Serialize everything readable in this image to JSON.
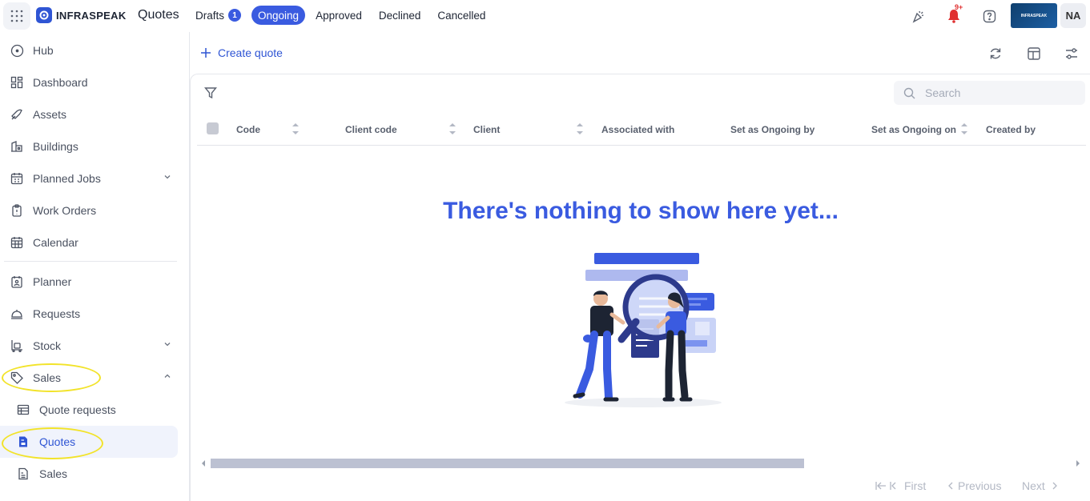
{
  "app": {
    "brand": "INFRASPEAK",
    "title": "Quotes",
    "org_logo_text": "INFRASPEAK",
    "user_initials": "NA"
  },
  "tabs": [
    {
      "label": "Drafts",
      "badge": "1"
    },
    {
      "label": "Ongoing",
      "active": true
    },
    {
      "label": "Approved"
    },
    {
      "label": "Declined"
    },
    {
      "label": "Cancelled"
    }
  ],
  "notifications": {
    "count": "9+"
  },
  "sidebar": {
    "items": [
      {
        "label": "Hub",
        "icon": "hub-icon"
      },
      {
        "label": "Dashboard",
        "icon": "dashboard-icon"
      },
      {
        "label": "Assets",
        "icon": "assets-icon"
      },
      {
        "label": "Buildings",
        "icon": "buildings-icon"
      },
      {
        "label": "Planned Jobs",
        "icon": "calendar-check-icon"
      },
      {
        "label": "Work Orders",
        "icon": "clipboard-icon"
      },
      {
        "label": "Calendar",
        "icon": "calendar-icon"
      },
      {
        "label": "Planner",
        "icon": "planner-icon"
      },
      {
        "label": "Requests",
        "icon": "bell-service-icon"
      },
      {
        "label": "Stock",
        "icon": "stock-icon"
      },
      {
        "label": "Sales",
        "icon": "tag-icon"
      },
      {
        "label": "Quote requests",
        "icon": "table-icon"
      },
      {
        "label": "Quotes",
        "icon": "quote-icon"
      },
      {
        "label": "Sales",
        "icon": "sales-doc-icon"
      }
    ]
  },
  "toolbar": {
    "create_label": "Create quote"
  },
  "search": {
    "placeholder": "Search"
  },
  "table": {
    "columns": [
      "Code",
      "Client code",
      "Client",
      "Associated with",
      "Set as Ongoing by",
      "Set as Ongoing on",
      "Created by"
    ]
  },
  "empty_state": {
    "title": "There's nothing to show here yet..."
  },
  "pagination": {
    "first": "First",
    "previous": "Previous",
    "next": "Next"
  },
  "colors": {
    "accent": "#3a5be0",
    "highlight": "#f2e32a"
  }
}
